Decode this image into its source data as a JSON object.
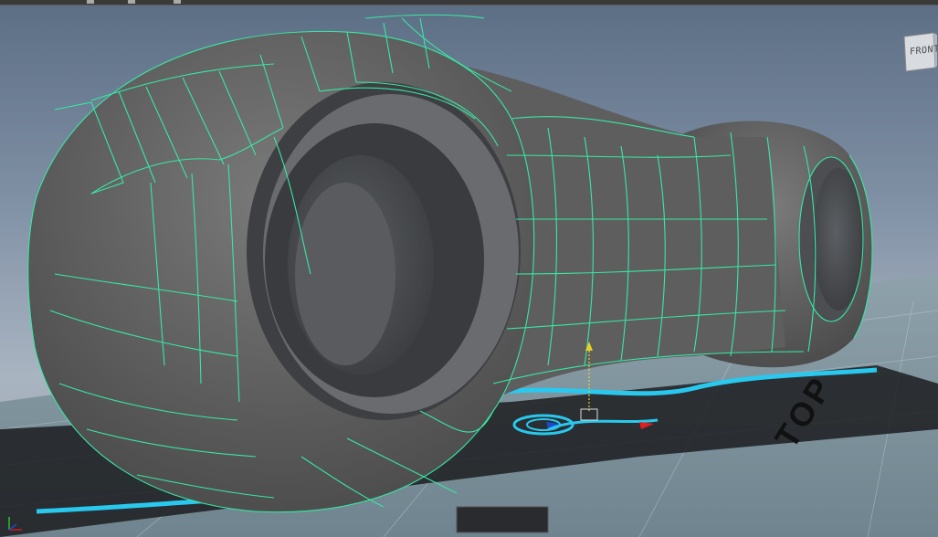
{
  "viewport": {
    "view_cube_label": "FRONT",
    "floor_text": "TOP",
    "colors": {
      "wireframe": "#37e8a4",
      "mesh_fill": "#5a5a5a",
      "mesh_shadow": "#3a3a3a",
      "floor": "#7a8c95",
      "accent_cyan": "#29c8ee",
      "axis_x": "#d21a1a",
      "axis_y": "#2ac02a",
      "axis_z": "#1a4ad2"
    },
    "icons": [
      "view-cube-icon",
      "axis-gizmo-icon",
      "manipulator-icon"
    ]
  }
}
